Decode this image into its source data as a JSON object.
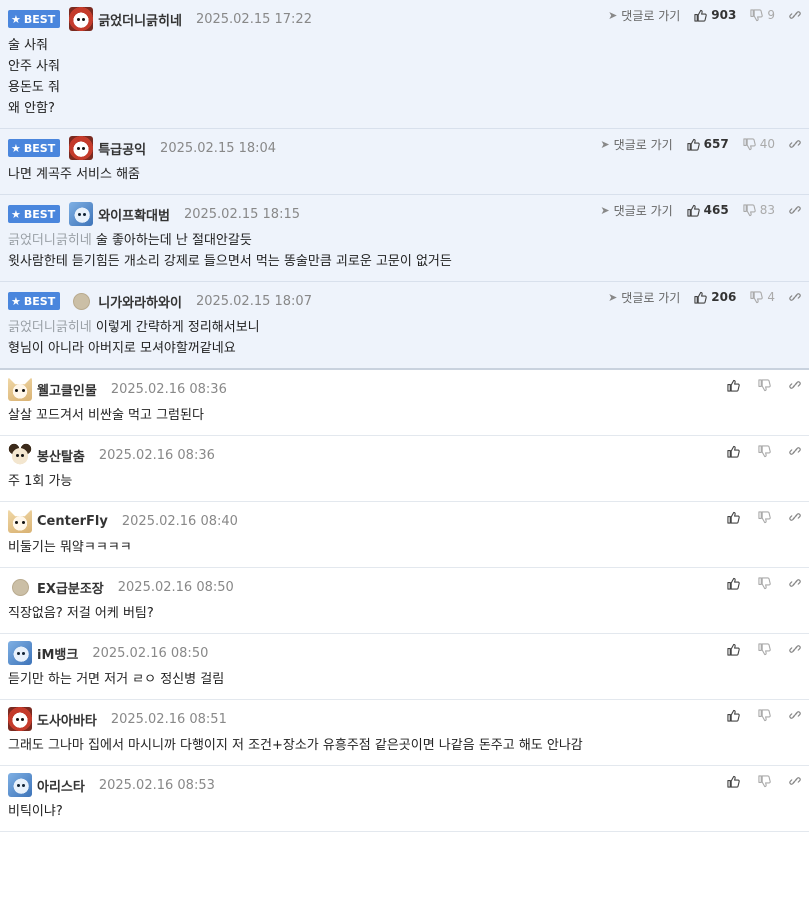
{
  "best_label": "BEST",
  "goto_label": "댓글로 가기",
  "comments": [
    {
      "best": true,
      "avatar": "red-dog",
      "nick": "긁었더니긁히네",
      "date": "2025.02.15 17:22",
      "up": "903",
      "down": "9",
      "mention": "",
      "lines": [
        "술 사줘",
        "안주 사줘",
        "용돈도 줘",
        "왜 안함?"
      ]
    },
    {
      "best": true,
      "avatar": "red-dog",
      "nick": "특급공익",
      "date": "2025.02.15 18:04",
      "up": "657",
      "down": "40",
      "mention": "",
      "lines": [
        "나면 계곡주 서비스 해줌"
      ]
    },
    {
      "best": true,
      "avatar": "blue-dog",
      "nick": "와이프확대범",
      "date": "2025.02.15 18:15",
      "up": "465",
      "down": "83",
      "mention": "긁었더니긁히네",
      "lines": [
        "술 좋아하는데 난 절대안갈듯",
        "윗사람한테 듣기힘든 개소리 강제로 들으면서 먹는 똥술만큼 괴로운 고문이 없거든"
      ]
    },
    {
      "best": true,
      "avatar": "dot",
      "nick": "니가와라하와이",
      "date": "2025.02.15 18:07",
      "up": "206",
      "down": "4",
      "mention": "긁었더니긁히네",
      "lines": [
        "이렇게 간략하게 정리해서보니",
        "형님이 아니라 아버지로 모셔야할꺼같네요"
      ]
    },
    {
      "best": false,
      "avatar": "fox",
      "nick": "웰고클인물",
      "date": "2025.02.16 08:36",
      "mention": "",
      "lines": [
        "살살 꼬드겨서 비싼술 먹고 그럼된다"
      ]
    },
    {
      "best": false,
      "avatar": "dog",
      "nick": "봉산탈춤",
      "date": "2025.02.16 08:36",
      "mention": "",
      "lines": [
        "주 1회 가능"
      ]
    },
    {
      "best": false,
      "avatar": "fox",
      "nick": "CenterFly",
      "date": "2025.02.16 08:40",
      "mention": "",
      "lines": [
        "비둘기는 뭐얔ㅋㅋㅋㅋ"
      ]
    },
    {
      "best": false,
      "avatar": "dot",
      "nick": "EX급분조장",
      "date": "2025.02.16 08:50",
      "mention": "",
      "lines": [
        "직장없음? 저걸 어케 버팀?"
      ]
    },
    {
      "best": false,
      "avatar": "blue-dog",
      "nick": "iM뱅크",
      "date": "2025.02.16 08:50",
      "mention": "",
      "lines": [
        "듣기만 하는 거면 저거 ㄹㅇ 정신병 걸림"
      ]
    },
    {
      "best": false,
      "avatar": "red-dog",
      "nick": "도사아바타",
      "date": "2025.02.16 08:51",
      "mention": "",
      "lines": [
        "그래도 그나마 집에서 마시니까 다행이지 저 조건+장소가 유흥주점 같은곳이면 나같음 돈주고 해도 안나감"
      ]
    },
    {
      "best": false,
      "avatar": "blue-dog",
      "nick": "아리스타",
      "date": "2025.02.16 08:53",
      "mention": "",
      "lines": [
        "비틱이냐?"
      ]
    }
  ]
}
